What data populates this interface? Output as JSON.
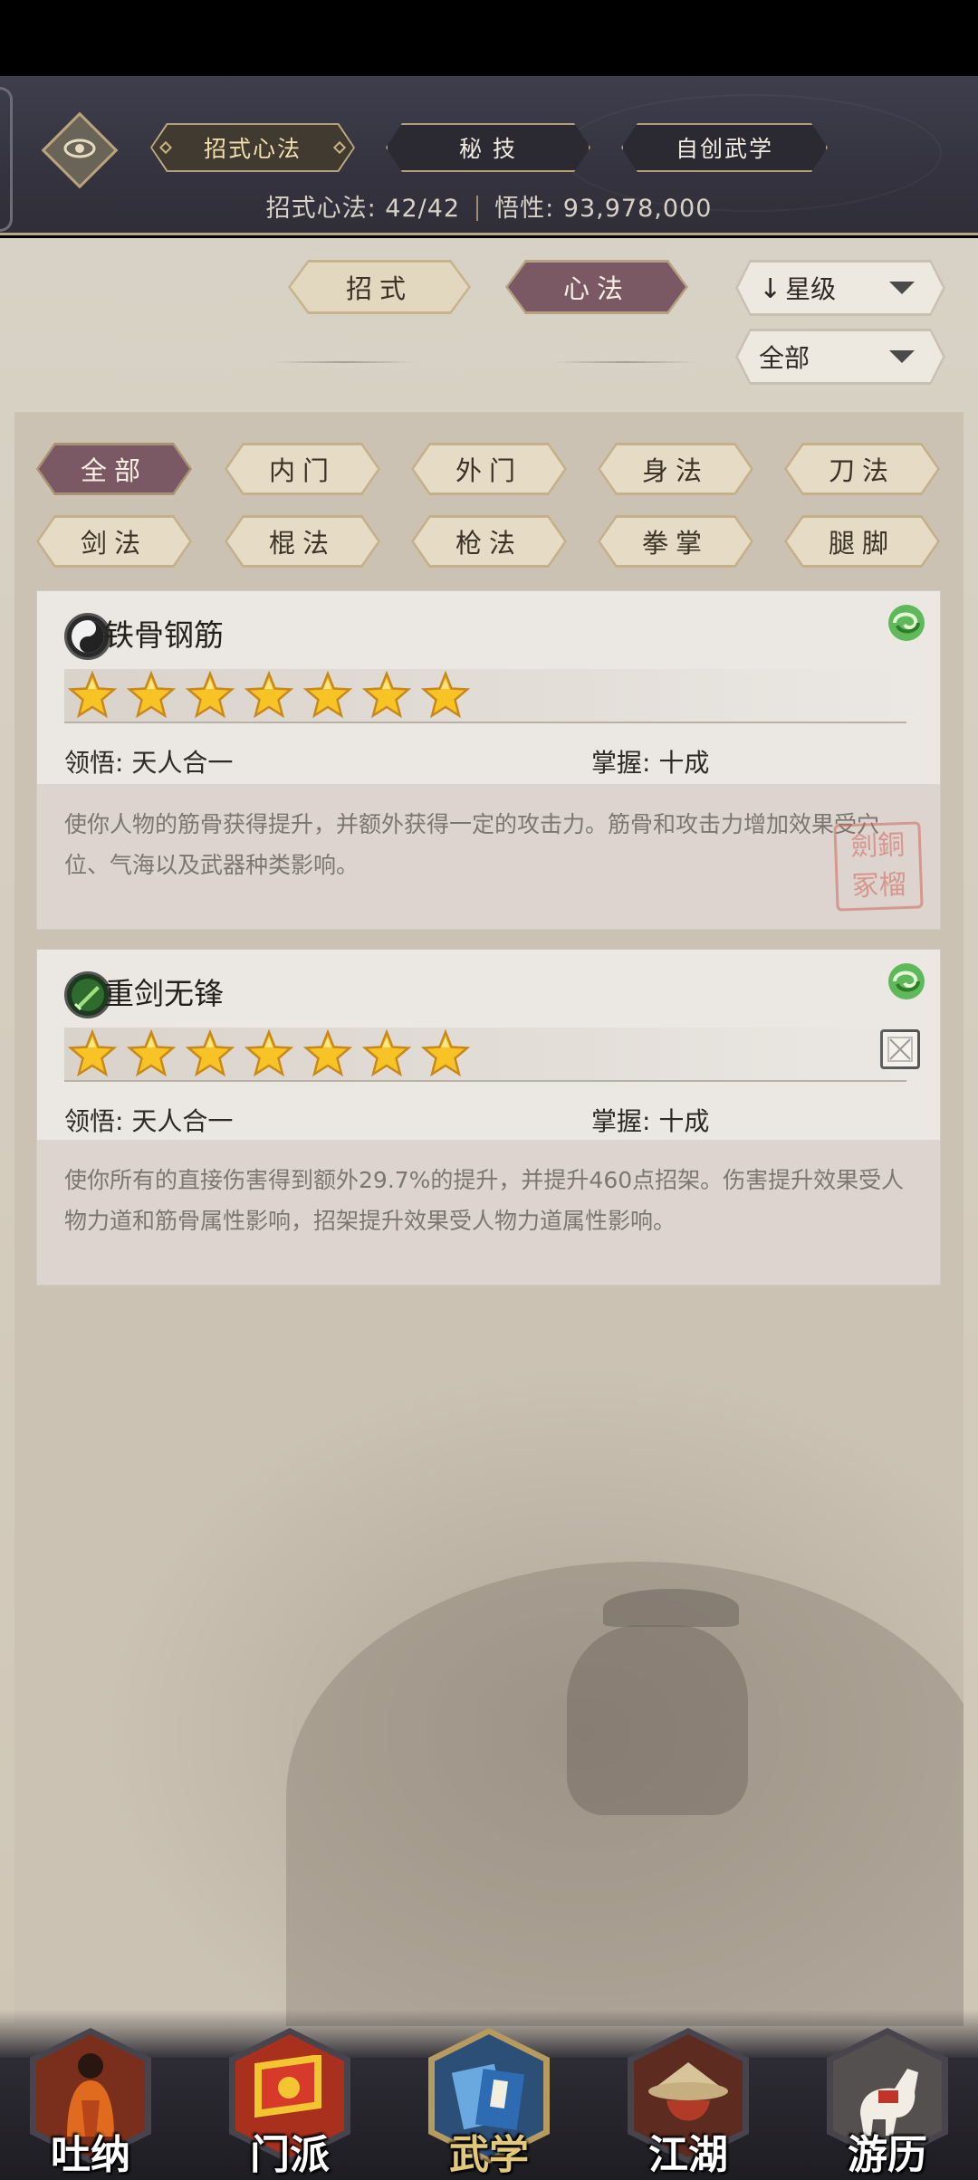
{
  "header": {
    "tabs": [
      {
        "label": "招式心法",
        "active": true
      },
      {
        "label": "秘 技",
        "active": false
      },
      {
        "label": "自创武学",
        "active": false
      }
    ],
    "stats": {
      "count_label": "招式心法: 42/42",
      "insight_label": "悟性: 93,978,000"
    }
  },
  "subtabs": [
    {
      "label": "招式",
      "active": false
    },
    {
      "label": "心法",
      "active": true
    }
  ],
  "sort": {
    "arrow": "↓",
    "label": "星级"
  },
  "scope": {
    "label": "全部"
  },
  "filters": [
    {
      "label": "全部",
      "active": true
    },
    {
      "label": "内门",
      "active": false
    },
    {
      "label": "外门",
      "active": false
    },
    {
      "label": "身法",
      "active": false
    },
    {
      "label": "刀法",
      "active": false
    },
    {
      "label": "剑法",
      "active": false
    },
    {
      "label": "棍法",
      "active": false
    },
    {
      "label": "枪法",
      "active": false
    },
    {
      "label": "拳掌",
      "active": false
    },
    {
      "label": "腿脚",
      "active": false
    }
  ],
  "cards": [
    {
      "title": "铁骨钢筋",
      "icon": "yin-yang-icon",
      "stars": 7,
      "comprehension": "领悟: 天人合一",
      "mastery": "掌握: 十成",
      "description": "使你人物的筋骨获得提升，并额外获得一定的攻击力。筋骨和攻击力增加效果受穴位、气海以及武器种类影响。",
      "seal": "劍銅 冢榴"
    },
    {
      "title": "重剑无锋",
      "icon": "sword-icon",
      "stars": 7,
      "comprehension": "领悟: 天人合一",
      "mastery": "掌握: 十成",
      "description": "使你所有的直接伤害得到额外29.7%的提升，并提升460点招架。伤害提升效果受人物力道和筋骨属性影响，招架提升效果受人物力道属性影响。"
    }
  ],
  "bottom_nav": [
    {
      "label": "吐纳",
      "icon": "monk-icon",
      "active": false
    },
    {
      "label": "门派",
      "icon": "banner-icon",
      "active": false
    },
    {
      "label": "武学",
      "icon": "scroll-book-icon",
      "active": true
    },
    {
      "label": "江湖",
      "icon": "straw-hat-icon",
      "active": false
    },
    {
      "label": "游历",
      "icon": "horse-icon",
      "active": false
    }
  ],
  "colors": {
    "accent_active": "#7b5964",
    "gold": "#c6ad7e",
    "parchment": "#d8d2c6"
  }
}
